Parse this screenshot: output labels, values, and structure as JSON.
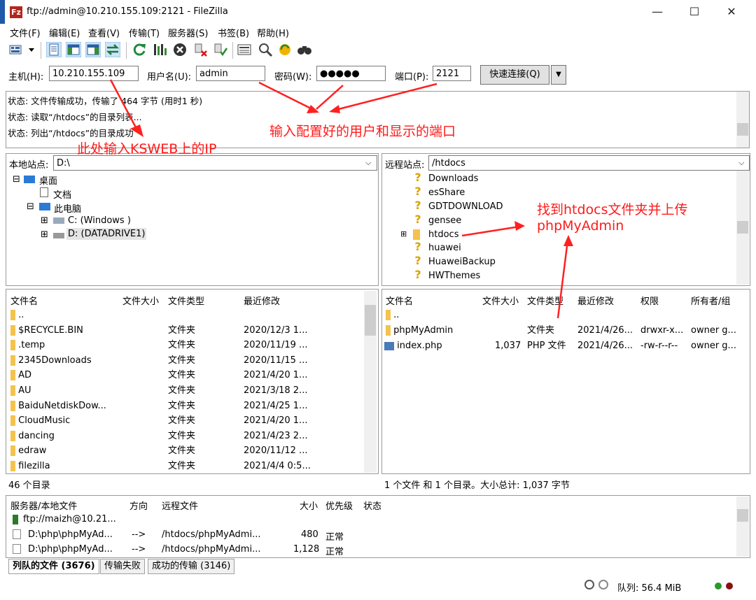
{
  "window": {
    "title": "ftp://admin@10.210.155.109:2121 - FileZilla",
    "app_icon": "Fz",
    "minimize": "—",
    "maximize": "☐",
    "close": "✕"
  },
  "menu": [
    "文件(F)",
    "编辑(E)",
    "查看(V)",
    "传输(T)",
    "服务器(S)",
    "书签(B)",
    "帮助(H)"
  ],
  "quickconnect": {
    "host_label": "主机(H):",
    "host_value": "10.210.155.109",
    "user_label": "用户名(U):",
    "user_value": "admin",
    "password_label": "密码(W):",
    "password_value": "●●●●●",
    "port_label": "端口(P):",
    "port_value": "2121",
    "button_label": "快速连接(Q)"
  },
  "log": [
    "状态:  文件传输成功，传输了 464 字节 (用时1 秒)",
    "状态:  读取“/htdocs”的目录列表...",
    "状态:  列出“/htdocs”的目录成功"
  ],
  "annotations": {
    "host_note": "此处输入KSWEB上的IP",
    "user_port_note": "输入配置好的用户和显示的端口",
    "htdocs_note_line1": "找到htdocs文件夹并上传",
    "htdocs_note_line2": "phpMyAdmin"
  },
  "local": {
    "site_label": "本地站点:",
    "site_path": "D:\\",
    "tree": [
      "桌面",
      "文档",
      "此电脑",
      "C: (Windows )",
      "D: (DATADRIVE1)"
    ],
    "columns": [
      "文件名",
      "文件大小",
      "文件类型",
      "最近修改"
    ],
    "rows": [
      {
        "name": "..",
        "size": "",
        "type": "",
        "modified": ""
      },
      {
        "name": "$RECYCLE.BIN",
        "size": "",
        "type": "文件夹",
        "modified": "2020/12/3 1..."
      },
      {
        "name": ".temp",
        "size": "",
        "type": "文件夹",
        "modified": "2020/11/19 ..."
      },
      {
        "name": "2345Downloads",
        "size": "",
        "type": "文件夹",
        "modified": "2020/11/15 ..."
      },
      {
        "name": "AD",
        "size": "",
        "type": "文件夹",
        "modified": "2021/4/20 1..."
      },
      {
        "name": "AU",
        "size": "",
        "type": "文件夹",
        "modified": "2021/3/18 2..."
      },
      {
        "name": "BaiduNetdiskDow...",
        "size": "",
        "type": "文件夹",
        "modified": "2021/4/25 1..."
      },
      {
        "name": "CloudMusic",
        "size": "",
        "type": "文件夹",
        "modified": "2021/4/20 1..."
      },
      {
        "name": "dancing",
        "size": "",
        "type": "文件夹",
        "modified": "2021/4/23 2..."
      },
      {
        "name": "edraw",
        "size": "",
        "type": "文件夹",
        "modified": "2020/11/12 ..."
      },
      {
        "name": "filezilla",
        "size": "",
        "type": "文件夹",
        "modified": "2021/4/4 0:5..."
      }
    ],
    "status": "46 个目录"
  },
  "remote": {
    "site_label": "远程站点:",
    "site_path": "/htdocs",
    "tree": [
      "Downloads",
      "esShare",
      "GDTDOWNLOAD",
      "gensee",
      "htdocs",
      "huawei",
      "HuaweiBackup",
      "HWThemes"
    ],
    "columns": [
      "文件名",
      "文件大小",
      "文件类型",
      "最近修改",
      "权限",
      "所有者/组"
    ],
    "rows": [
      {
        "name": "..",
        "size": "",
        "type": "",
        "modified": "",
        "perm": "",
        "owner": ""
      },
      {
        "name": "phpMyAdmin",
        "size": "",
        "type": "文件夹",
        "modified": "2021/4/26...",
        "perm": "drwxr-x...",
        "owner": "owner g..."
      },
      {
        "name": "index.php",
        "size": "1,037",
        "type": "PHP 文件",
        "modified": "2021/4/26...",
        "perm": "-rw-r--r--",
        "owner": "owner g..."
      }
    ],
    "status": "1 个文件 和 1 个目录。大小总计: 1,037 字节"
  },
  "queue": {
    "columns": [
      "服务器/本地文件",
      "方向",
      "远程文件",
      "大小",
      "优先级",
      "状态"
    ],
    "server": "ftp://maizh@10.21...",
    "rows": [
      {
        "local": "D:\\php\\phpMyAd...",
        "dir": "-->",
        "remote": "/htdocs/phpMyAdmi...",
        "size": "480",
        "priority": "正常"
      },
      {
        "local": "D:\\php\\phpMyAd...",
        "dir": "-->",
        "remote": "/htdocs/phpMyAdmi...",
        "size": "1,128",
        "priority": "正常"
      }
    ],
    "tabs": [
      "列队的文件 (3676)",
      "传输失败",
      "成功的传输 (3146)"
    ]
  },
  "statusbar": {
    "queue_text": "队列: 56.4 MiB"
  }
}
